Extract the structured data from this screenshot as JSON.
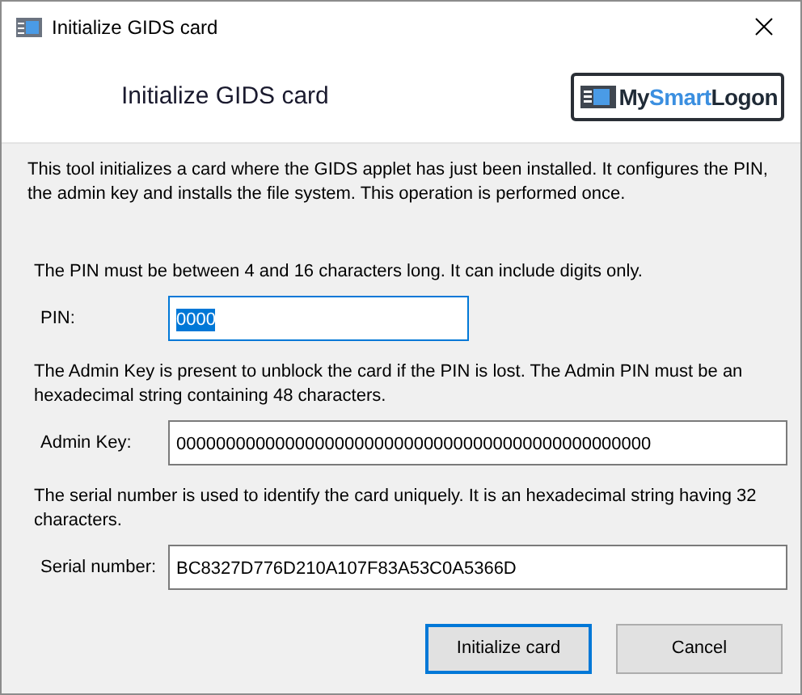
{
  "window": {
    "title": "Initialize GIDS card"
  },
  "header": {
    "title": "Initialize GIDS card",
    "logo": [
      {
        "text": "My",
        "color": "#1f2a36"
      },
      {
        "text": "Smart",
        "color": "#3b8fe0"
      },
      {
        "text": "Logon",
        "color": "#1f2a36"
      }
    ]
  },
  "description": "This tool initializes a card where the GIDS applet has just been installed. It configures the PIN, the admin key and installs the file system. This operation is performed once.",
  "sections": [
    {
      "hint": "The PIN must be between 4 and 16 characters long. It can include digits only.",
      "label": "PIN:",
      "value": "0000",
      "focused": true,
      "text_selected": true,
      "wide": false
    },
    {
      "hint": "The Admin Key is present to unblock the card if the PIN is lost. The Admin PIN must be an hexadecimal string containing 48 characters.",
      "label": "Admin Key:",
      "value": "000000000000000000000000000000000000000000000000",
      "focused": false,
      "text_selected": false,
      "wide": true
    },
    {
      "hint": "The serial number is used to identify the card uniquely. It is an hexadecimal string having 32 characters.",
      "label": "Serial number:",
      "value": "BC8327D776D210A107F83A53C0A5366D",
      "focused": false,
      "text_selected": false,
      "wide": true
    }
  ],
  "buttons": [
    {
      "label": "Initialize card",
      "default": true
    },
    {
      "label": "Cancel",
      "default": false
    }
  ]
}
